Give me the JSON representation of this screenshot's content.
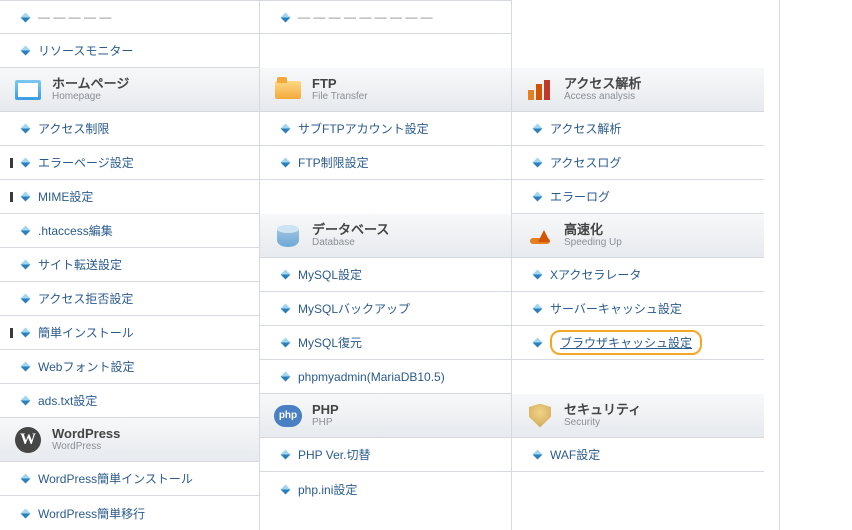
{
  "col1": {
    "top_items": [
      "リソースモニター"
    ],
    "header": {
      "jp": "ホームページ",
      "en": "Homepage"
    },
    "items": [
      "アクセス制限",
      "エラーページ設定",
      "MIME設定",
      ".htaccess編集",
      "サイト転送設定",
      "アクセス拒否設定",
      "簡単インストール",
      "Webフォント設定",
      "ads.txt設定"
    ],
    "header2": {
      "jp": "WordPress",
      "en": "WordPress"
    },
    "items2": [
      "WordPress簡単インストール",
      "WordPress簡単移行"
    ]
  },
  "col2": {
    "ftp": {
      "jp": "FTP",
      "en": "File Transfer"
    },
    "ftp_items": [
      "サブFTPアカウント設定",
      "FTP制限設定"
    ],
    "db": {
      "jp": "データベース",
      "en": "Database"
    },
    "db_items": [
      "MySQL設定",
      "MySQLバックアップ",
      "MySQL復元",
      "phpmyadmin(MariaDB10.5)"
    ],
    "php": {
      "jp": "PHP",
      "en": "PHP",
      "label": "php"
    },
    "php_items": [
      "PHP Ver.切替",
      "php.ini設定"
    ]
  },
  "col3": {
    "access": {
      "jp": "アクセス解析",
      "en": "Access analysis"
    },
    "access_items": [
      "アクセス解析",
      "アクセスログ",
      "エラーログ"
    ],
    "speed": {
      "jp": "高速化",
      "en": "Speeding Up"
    },
    "speed_items": [
      "Xアクセラレータ",
      "サーバーキャッシュ設定",
      "ブラウザキャッシュ設定"
    ],
    "sec": {
      "jp": "セキュリティ",
      "en": "Security"
    },
    "sec_items": [
      "WAF設定"
    ]
  }
}
